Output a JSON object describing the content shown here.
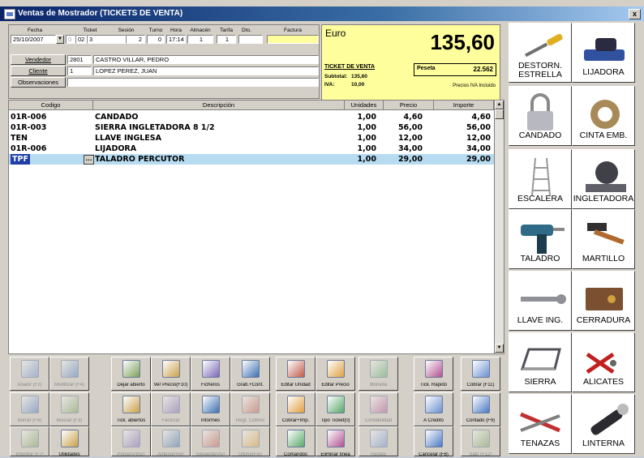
{
  "window": {
    "title": "Ventas de Mostrador (TICKETS DE VENTA)",
    "close_label": "x"
  },
  "header": {
    "labels": {
      "fecha": "Fecha",
      "ticket": "Ticket",
      "sesion": "Sesión",
      "turno": "Turno",
      "hora": "Hora",
      "almacen": "Almacén",
      "tarifa": "Tarifa",
      "dto": "Dto.",
      "factura": "Factura"
    },
    "values": {
      "fecha": "25/10/2007",
      "ticket_serie": "0",
      "ticket_a": "02",
      "ticket_b": "3",
      "sesion": "2",
      "turno": "0",
      "hora": "17:14",
      "almacen": "1",
      "tarifa": "1",
      "dto": "",
      "factura": ""
    },
    "vendedor": {
      "button": "Vendedor",
      "code": "2801",
      "name": "CASTRO VILLAR, PEDRO"
    },
    "cliente": {
      "button": "Cliente",
      "code": "1",
      "name": "LOPEZ PEREZ, JUAN"
    },
    "observaciones": {
      "button": "Observaciones",
      "value": ""
    }
  },
  "totals": {
    "currency": "Euro",
    "total": "135,60",
    "ticket_label": "TICKET DE VENTA",
    "subtotal_label": "Subtotal:",
    "subtotal": "135,60",
    "iva_label": "IVA:",
    "iva": "10,00",
    "alt_currency": "Peseta",
    "alt_total": "22.562",
    "note": "Precios IVA Incluido"
  },
  "grid": {
    "columns": [
      "Codigo",
      "Descripción",
      "Unidades",
      "Precio",
      "Importe"
    ],
    "rows": [
      {
        "codigo": "01R-006",
        "descripcion": "CANDADO",
        "unidades": "1,00",
        "precio": "4,60",
        "importe": "4,60"
      },
      {
        "codigo": "01R-003",
        "descripcion": "SIERRA INGLETADORA 8 1/2",
        "unidades": "1,00",
        "precio": "56,00",
        "importe": "56,00"
      },
      {
        "codigo": "TEN",
        "descripcion": "LLAVE INGLESA",
        "unidades": "1,00",
        "precio": "12,00",
        "importe": "12,00"
      },
      {
        "codigo": "01R-006",
        "descripcion": "LIJADORA",
        "unidades": "1,00",
        "precio": "34,00",
        "importe": "34,00"
      },
      {
        "codigo": "TPF",
        "descripcion": "TALADRO PERCUTOR",
        "unidades": "1,00",
        "precio": "29,00",
        "importe": "29,00",
        "selected": true
      }
    ],
    "selection_color": "#b7dcf2"
  },
  "toolbar": {
    "row1": [
      {
        "label": "Añadir (F2)",
        "icon": "document-add-icon",
        "disabled": true
      },
      {
        "label": "Modificar (F4)",
        "icon": "edit-icon",
        "disabled": true
      },
      {
        "label": "Dejar abierto",
        "icon": "leave-open-icon"
      },
      {
        "label": "Ver Precio(F10)",
        "icon": "view-price-icon"
      },
      {
        "label": "Ficheros",
        "icon": "files-icon"
      },
      {
        "label": "Grab.+Cont.",
        "icon": "save-icon"
      },
      {
        "label": "Editar Unidad",
        "icon": "edit-unit-icon"
      },
      {
        "label": "Editar Precio",
        "icon": "edit-price-icon"
      },
      {
        "label": "Moneda",
        "icon": "currency-icon",
        "disabled": true
      },
      {
        "label": "Tick. Rápido",
        "icon": "quick-ticket-icon"
      },
      {
        "label": "Cobrar (F11)",
        "icon": "charge-icon"
      }
    ],
    "row2": [
      {
        "label": "Borrar (F6)",
        "icon": "delete-icon",
        "disabled": true
      },
      {
        "label": "Buscar (F3)",
        "icon": "search-icon",
        "disabled": true
      },
      {
        "label": "Tick. abiertos",
        "icon": "open-tickets-icon"
      },
      {
        "label": "Facturar",
        "icon": "invoice-icon",
        "disabled": true
      },
      {
        "label": "Informes",
        "icon": "reports-icon"
      },
      {
        "label": "Regt. Cobros",
        "icon": "payments-icon",
        "disabled": true
      },
      {
        "label": "Cobrar+Imp.",
        "icon": "charge-print-icon"
      },
      {
        "label": "Tipo Ticket(0)",
        "icon": "ticket-type-icon"
      },
      {
        "label": "Contabilidad",
        "icon": "accounting-icon",
        "disabled": true
      },
      {
        "label": "A Crédito",
        "icon": "credit-icon"
      },
      {
        "label": "Contado (F9)",
        "icon": "cash-icon"
      }
    ],
    "row3": [
      {
        "label": "Imprimir (F7)",
        "icon": "print-icon",
        "disabled": true
      },
      {
        "label": "Utilidades",
        "icon": "tools-icon"
      },
      {
        "label": "Primero(Inic)",
        "icon": "first-icon",
        "disabled": true
      },
      {
        "label": "Anterior(Re)",
        "icon": "previous-icon",
        "disabled": true
      },
      {
        "label": "Siguiente(Av)",
        "icon": "next-icon",
        "disabled": true
      },
      {
        "label": "Último(Fin)",
        "icon": "last-icon",
        "disabled": true
      },
      {
        "label": "Comandos",
        "icon": "commands-icon"
      },
      {
        "label": "Eliminar línea",
        "icon": "delete-line-icon"
      },
      {
        "label": "Regalo",
        "icon": "gift-icon",
        "disabled": true
      },
      {
        "label": "Cancelar (F8)",
        "icon": "cancel-icon"
      },
      {
        "label": "Salir (F12)",
        "icon": "exit-icon",
        "disabled": true
      }
    ]
  },
  "products": [
    {
      "label": "DESTORN. ESTRELLA",
      "icon": "screwdriver-icon"
    },
    {
      "label": "LIJADORA",
      "icon": "sander-icon"
    },
    {
      "label": "CANDADO",
      "icon": "padlock-icon"
    },
    {
      "label": "CINTA EMB.",
      "icon": "tape-icon"
    },
    {
      "label": "ESCALERA",
      "icon": "ladder-icon"
    },
    {
      "label": "INGLETADORA",
      "icon": "miter-saw-icon"
    },
    {
      "label": "TALADRO",
      "icon": "drill-icon"
    },
    {
      "label": "MARTILLO",
      "icon": "hammer-icon"
    },
    {
      "label": "LLAVE ING.",
      "icon": "wrench-icon"
    },
    {
      "label": "CERRADURA",
      "icon": "lock-icon"
    },
    {
      "label": "SIERRA",
      "icon": "hacksaw-icon"
    },
    {
      "label": "ALICATES",
      "icon": "pliers-icon"
    },
    {
      "label": "TENAZAS",
      "icon": "pincers-icon"
    },
    {
      "label": "LINTERNA",
      "icon": "flashlight-icon"
    }
  ]
}
